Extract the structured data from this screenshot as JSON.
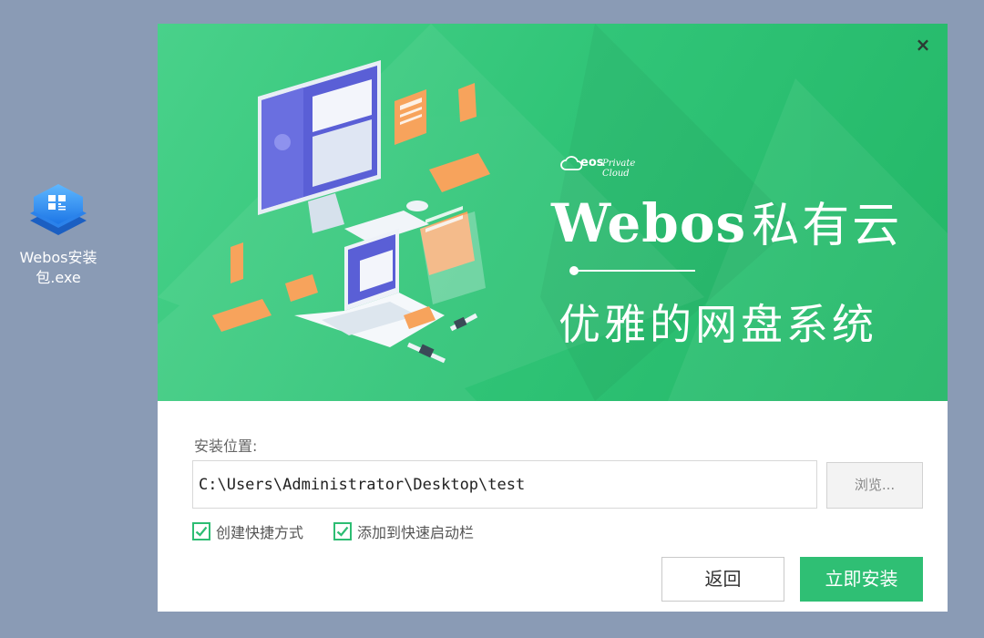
{
  "desktop": {
    "icon_label": "Webos安装包.exe",
    "icon": "webos-app-icon"
  },
  "installer": {
    "close_symbol": "×",
    "banner": {
      "logo_text": "eos",
      "logo_subtitle": "Private Cloud",
      "brand_latin": "Webos",
      "brand_cn": "私有云",
      "slogan": "优雅的网盘系统"
    },
    "form": {
      "location_label": "安装位置:",
      "path_value": "C:\\Users\\Administrator\\Desktop\\test",
      "browse_label": "浏览...",
      "checkbox_shortcut": {
        "label": "创建快捷方式",
        "checked": true
      },
      "checkbox_quicklaunch": {
        "label": "添加到快速启动栏",
        "checked": true
      }
    },
    "buttons": {
      "back": "返回",
      "install": "立即安装"
    }
  },
  "colors": {
    "desktop_bg": "#8a9bb5",
    "accent_green": "#2fbf74",
    "banner_green": "#31c578"
  }
}
